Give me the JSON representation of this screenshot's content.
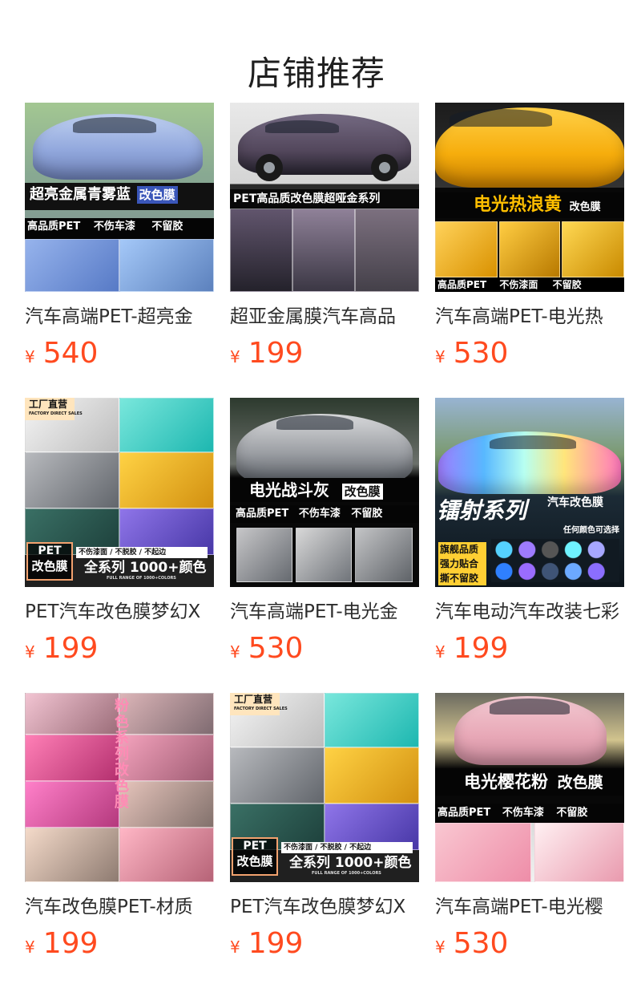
{
  "header": {
    "title": "店铺推荐"
  },
  "colors": {
    "price": "#ff4a1f",
    "title": "#1f1f1f",
    "product_title": "#2d2d2d"
  },
  "products": [
    {
      "title": "汽车高端PET-超亮金",
      "currency": "¥",
      "price": "540",
      "image_text": [
        "超亮金属青雾蓝",
        "改色膜",
        "高品质PET",
        "不伤车漆",
        "不留胶"
      ]
    },
    {
      "title": "超亚金属膜汽车高品",
      "currency": "¥",
      "price": "199",
      "image_text": [
        "PET高品质改色膜超哑金系列"
      ]
    },
    {
      "title": "汽车高端PET-电光热",
      "currency": "¥",
      "price": "530",
      "image_text": [
        "电光热浪黄",
        "改色膜",
        "高品质PET",
        "不伤漆面",
        "不留胶"
      ]
    },
    {
      "title": "PET汽车改色膜梦幻X",
      "currency": "¥",
      "price": "199",
      "image_text": [
        "工厂直营",
        "FACTORY DIRECT SALES",
        "PET",
        "改色膜",
        "不伤漆面 / 不脱胶 / 不起边",
        "全系列 1000+颜色",
        "FULL RANGE OF 1000+COLORS"
      ]
    },
    {
      "title": "汽车高端PET-电光金",
      "currency": "¥",
      "price": "530",
      "image_text": [
        "电光战斗灰",
        "改色膜",
        "高品质PET",
        "不伤车漆",
        "不留胶"
      ]
    },
    {
      "title": "汽车电动汽车改装七彩",
      "currency": "¥",
      "price": "199",
      "image_text": [
        "镭射系列",
        "汽车改色膜",
        "任何颜色可选择",
        "旗舰品质",
        "强力贴合",
        "撕不留胶"
      ]
    },
    {
      "title": "汽车改色膜PET-材质",
      "currency": "¥",
      "price": "199",
      "image_text": [
        "粉色系列改色膜"
      ]
    },
    {
      "title": "PET汽车改色膜梦幻X",
      "currency": "¥",
      "price": "199",
      "image_text": [
        "工厂直营",
        "FACTORY DIRECT SALES",
        "PET",
        "改色膜",
        "不伤漆面 / 不脱胶 / 不起边",
        "全系列 1000+颜色",
        "FULL RANGE OF 1000+COLORS"
      ]
    },
    {
      "title": "汽车高端PET-电光樱",
      "currency": "¥",
      "price": "530",
      "image_text": [
        "电光樱花粉",
        "改色膜",
        "高品质PET",
        "不伤车漆",
        "不留胶"
      ]
    }
  ]
}
